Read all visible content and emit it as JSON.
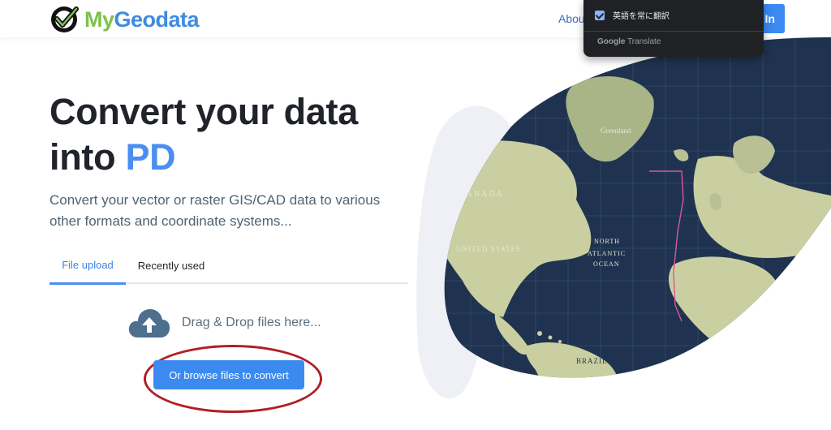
{
  "header": {
    "logo_my": "My",
    "logo_geodata": "Geodata",
    "nav_about": "Abou",
    "signin_label": "In"
  },
  "translate_popup": {
    "always_translate_label": "英語を常に翻訳",
    "brand_google": "Google",
    "brand_translate": "Translate",
    "checked": true
  },
  "hero": {
    "title_line1": "Convert your data",
    "title_into": "into ",
    "title_format": "PD",
    "subtitle": "Convert your vector or raster GIS/CAD data to various other formats and coordinate systems..."
  },
  "tabs": {
    "file_upload": "File upload",
    "recently_used": "Recently used",
    "active": "File upload"
  },
  "upload": {
    "drag_drop_text": "Drag & Drop files here...",
    "browse_button": "Or browse files to convert"
  },
  "map_labels": {
    "greenland": "Greenland",
    "canada": "CANADA",
    "united_states": "UNITED STATES",
    "north": "NORTH",
    "atlantic": "ATLANTIC",
    "ocean": "OCEAN",
    "brazil": "BRAZIL"
  },
  "colors": {
    "accent": "#3b8af0",
    "logo_green": "#7dc24b",
    "logo_blue": "#3f8be0",
    "annotation_red": "#b11f24",
    "map_ocean": "#1f3350",
    "map_land": "#c9cfa0"
  },
  "icons": {
    "logo": "checkmark-circle-icon",
    "upload": "cloud-upload-icon",
    "checkbox": "checkbox-checked-icon"
  }
}
